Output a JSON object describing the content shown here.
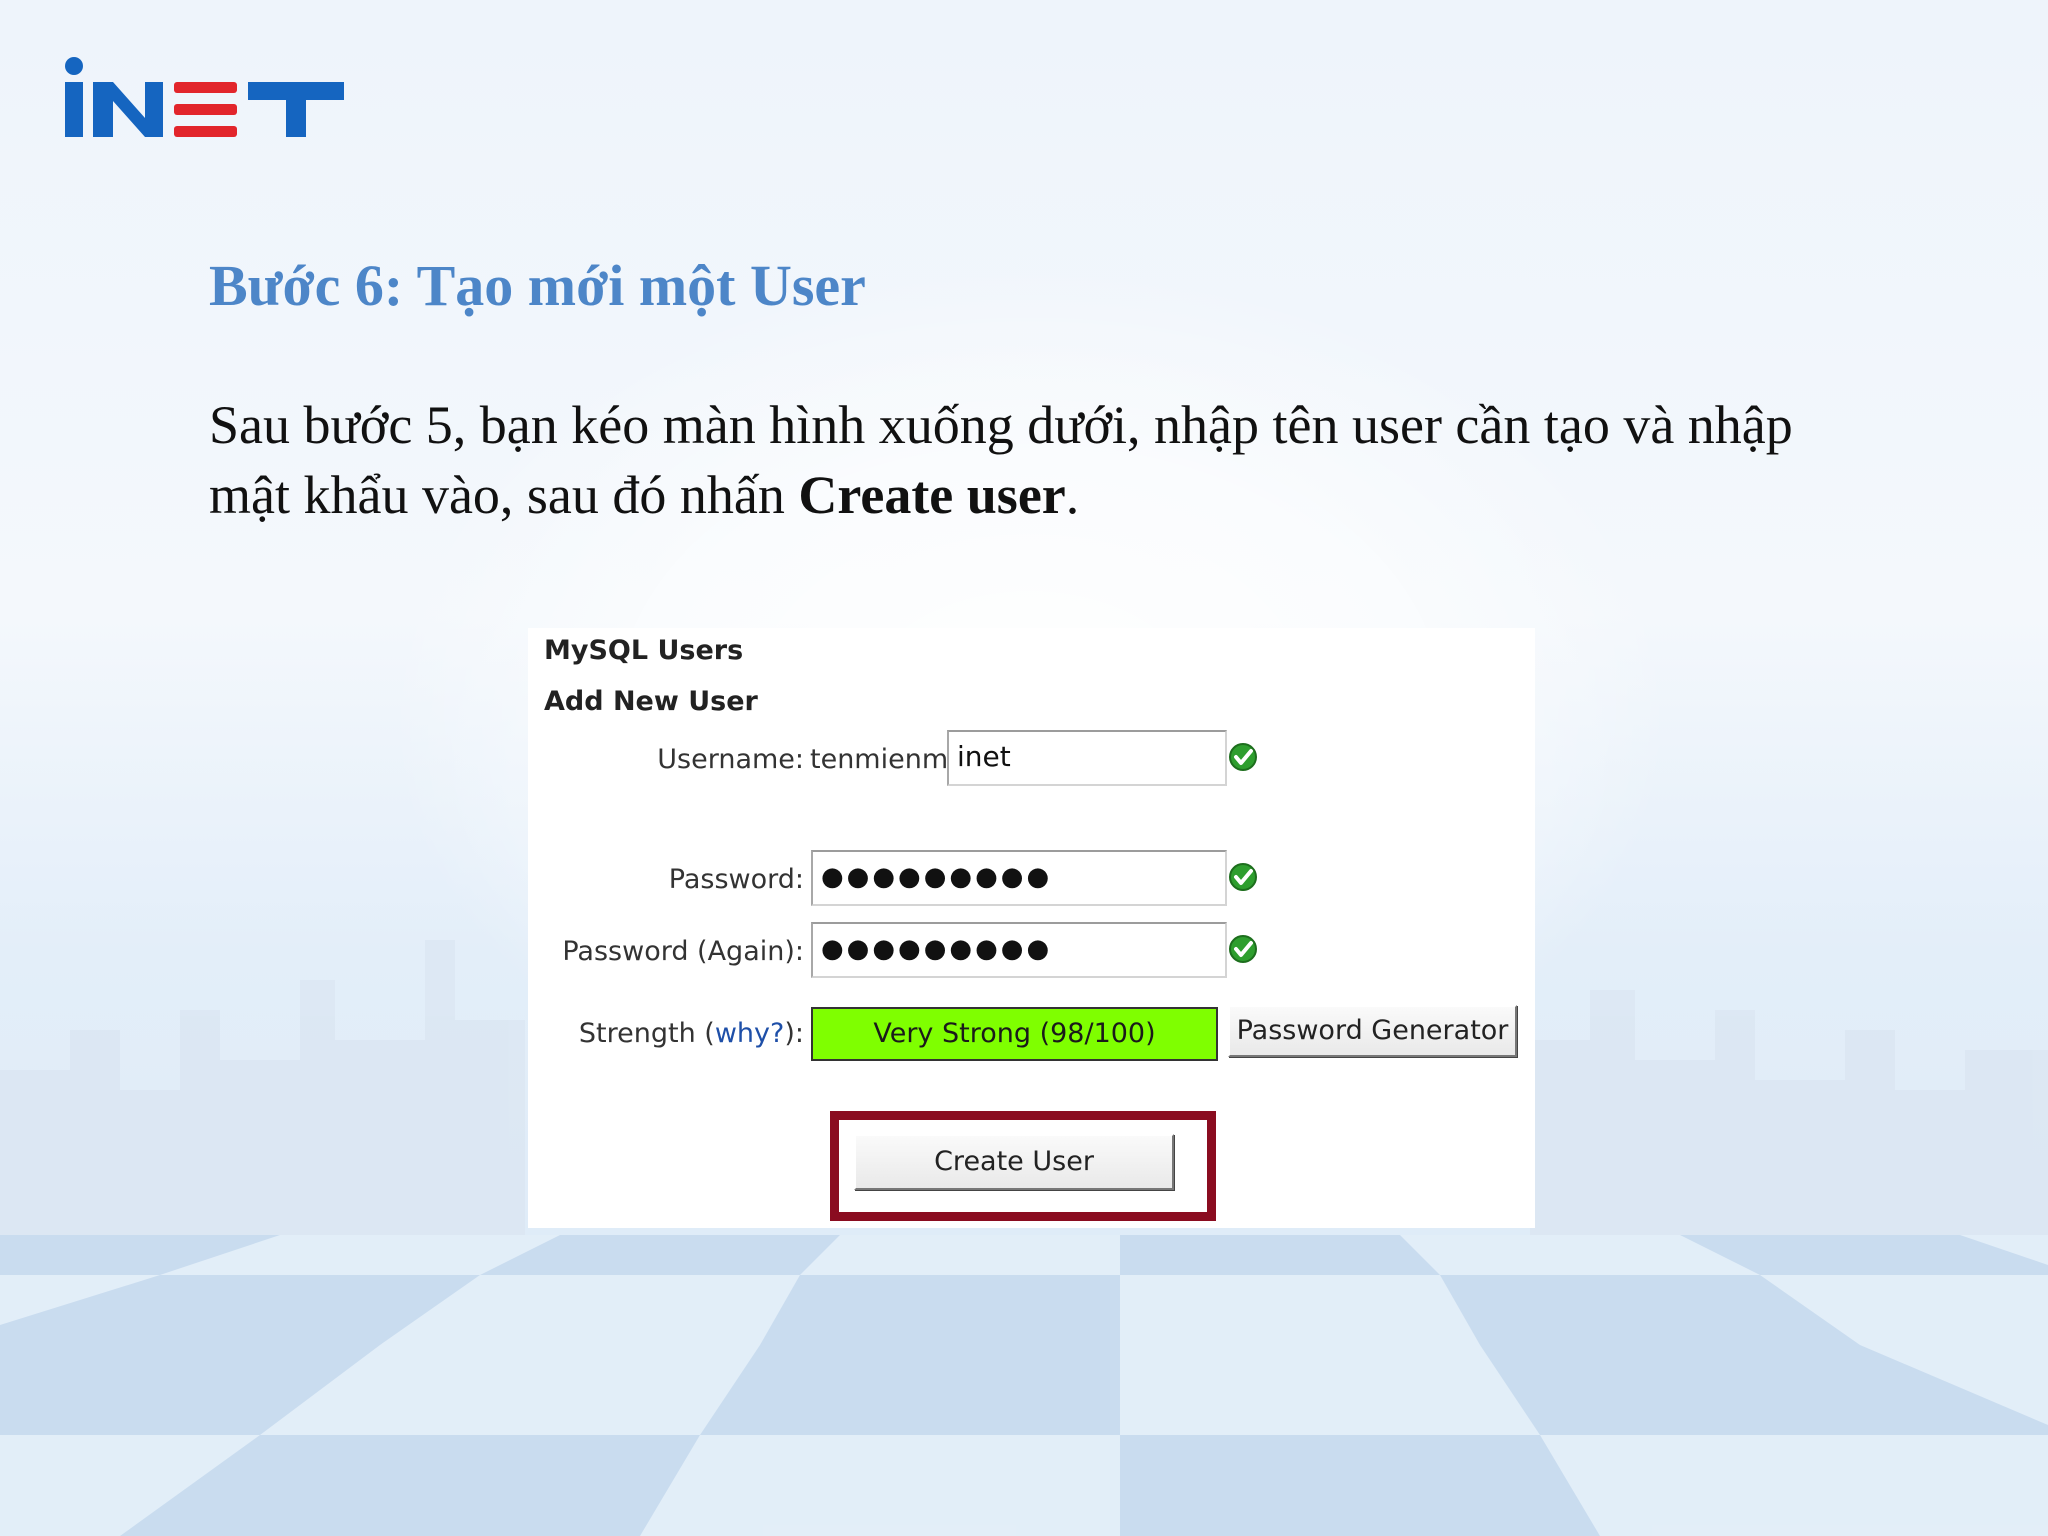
{
  "brand": {
    "logo_text": "iNET",
    "logo_blue": "#1565c0",
    "logo_red": "#e2252b"
  },
  "slide": {
    "title": "Bước 6: Tạo mới một User",
    "body_normal": "Sau bước 5, bạn kéo màn hình xuống dưới, nhập tên user cần tạo và nhập mật khẩu vào, sau đó nhấn ",
    "body_bold": "Create user",
    "body_end": ".",
    "title_color": "#4d86c8"
  },
  "screenshot": {
    "section_title": "MySQL Users",
    "subsection_title": "Add New User",
    "username_label": "Username:",
    "username_prefix": "tenmienm_",
    "username_value": "inet",
    "password_label": "Password:",
    "password_value": "●●●●●●●●●",
    "password_again_label": "Password (Again):",
    "password_again_value": "●●●●●●●●●",
    "strength_label_start": "Strength (",
    "strength_link": "why?",
    "strength_label_end": "):",
    "strength_value": "Very Strong (98/100)",
    "strength_color": "#7fff00",
    "generator_button": "Password Generator",
    "create_button": "Create User",
    "highlight_color": "#8a0c20",
    "valid_icon": "check-circle-icon"
  }
}
